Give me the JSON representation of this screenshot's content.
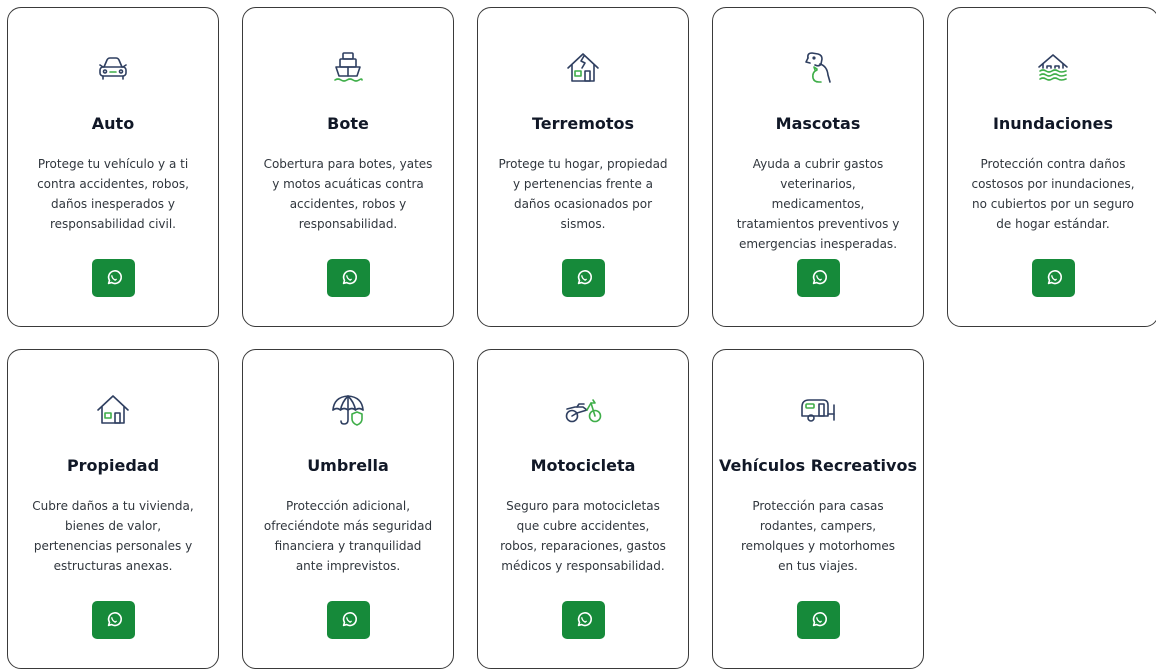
{
  "colors": {
    "icon_primary": "#2f3f60",
    "icon_accent": "#3fae49",
    "button_bg": "#168a3a"
  },
  "cards": [
    {
      "title": "Auto",
      "icon": "car-icon",
      "description": "Protege tu vehículo y a ti contra accidentes, robos, daños inesperados y responsabilidad civil."
    },
    {
      "title": "Bote",
      "icon": "boat-icon",
      "description": "Cobertura para botes, yates y motos acuáticas contra accidentes, robos y responsabilidad."
    },
    {
      "title": "Terremotos",
      "icon": "earthquake-house-icon",
      "description": "Protege tu hogar, propiedad y pertenencias frente a daños ocasionados por sismos."
    },
    {
      "title": "Mascotas",
      "icon": "pets-icon",
      "description": "Ayuda a cubrir gastos veterinarios, medicamentos, tratamientos preventivos y emergencias inesperadas."
    },
    {
      "title": "Inundaciones",
      "icon": "flood-house-icon",
      "description": "Protección contra daños costosos por inundaciones, no cubiertos por un seguro de hogar estándar."
    },
    {
      "title": "Propiedad",
      "icon": "house-icon",
      "description": "Cubre daños a tu vivienda, bienes de valor, pertenencias personales y estructuras anexas."
    },
    {
      "title": "Umbrella",
      "icon": "umbrella-shield-icon",
      "description": "Protección adicional, ofreciéndote más seguridad financiera y tranquilidad ante imprevistos."
    },
    {
      "title": "Motocicleta",
      "icon": "motorcycle-icon",
      "description": "Seguro para motocicletas que cubre accidentes, robos, reparaciones, gastos médicos y responsabilidad."
    },
    {
      "title": "Vehículos Recreativos",
      "icon": "rv-trailer-icon",
      "description": "Protección para casas rodantes, campers, remolques y motorhomes en tus viajes."
    }
  ],
  "button": {
    "icon": "whatsapp-icon"
  }
}
